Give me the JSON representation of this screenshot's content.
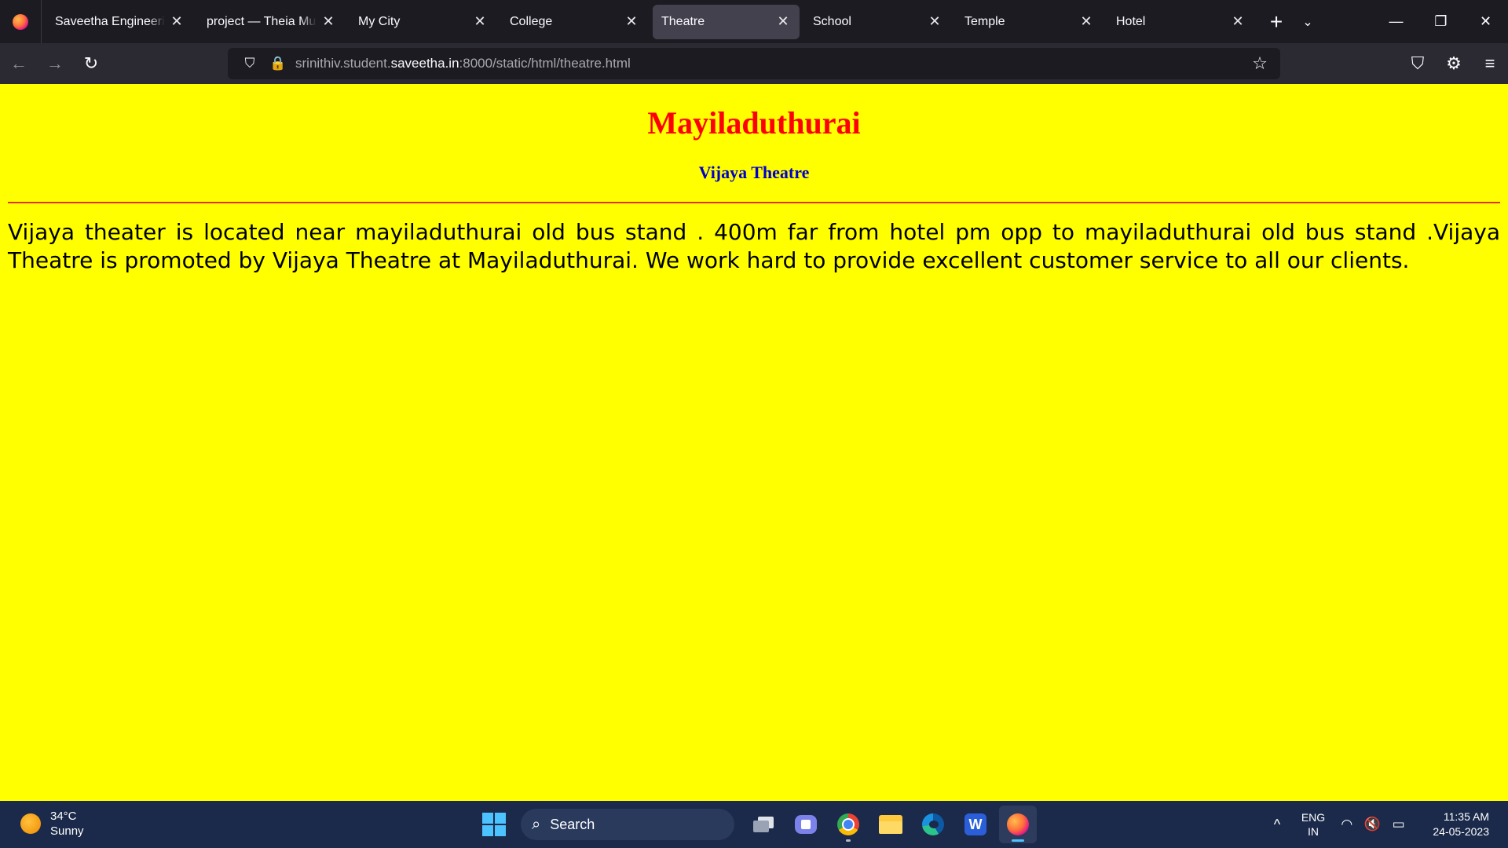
{
  "browser": {
    "tabs": [
      {
        "label": "Saveetha Engineering",
        "active": false
      },
      {
        "label": "project — Theia Multi-",
        "active": false
      },
      {
        "label": "My City",
        "active": false
      },
      {
        "label": "College",
        "active": false
      },
      {
        "label": "Theatre",
        "active": true
      },
      {
        "label": "School",
        "active": false
      },
      {
        "label": "Temple",
        "active": false
      },
      {
        "label": "Hotel",
        "active": false
      }
    ],
    "url": {
      "prefix": "srinithiv.student.",
      "domain": "saveetha.in",
      "suffix": ":8000/static/html/theatre.html"
    },
    "icons": {
      "close": "✕",
      "new_tab": "+",
      "tab_list": "⌄",
      "minimize": "—",
      "restore": "❐",
      "window_close": "✕",
      "back": "←",
      "forward": "→",
      "reload": "↻",
      "shield": "⛉",
      "lock": "🔒",
      "star": "☆",
      "pocket": "⛉",
      "extensions": "⚙",
      "menu": "≡"
    }
  },
  "page": {
    "title": "Mayiladuthurai",
    "subtitle": "Vijaya Theatre",
    "paragraph": "Vijaya theater is located near mayiladuthurai old bus stand . 400m far from hotel pm opp to mayiladuthurai old bus stand .Vijaya Theatre is promoted by Vijaya Theatre at Mayiladuthurai. We work hard to provide excellent customer service to all our clients.",
    "colors": {
      "background": "#ffff00",
      "title": "#ff0000",
      "subtitle": "#0000cc",
      "rule": "#e0301e"
    }
  },
  "taskbar": {
    "weather": {
      "temp": "34°C",
      "condition": "Sunny"
    },
    "search_label": "Search",
    "language": {
      "line1": "ENG",
      "line2": "IN"
    },
    "clock": {
      "time": "11:35 AM",
      "date": "24-05-2023"
    },
    "icons": {
      "search": "⌕",
      "chevron_up": "^",
      "wifi": "◠",
      "volume_muted": "🔇",
      "battery": "▭"
    }
  }
}
